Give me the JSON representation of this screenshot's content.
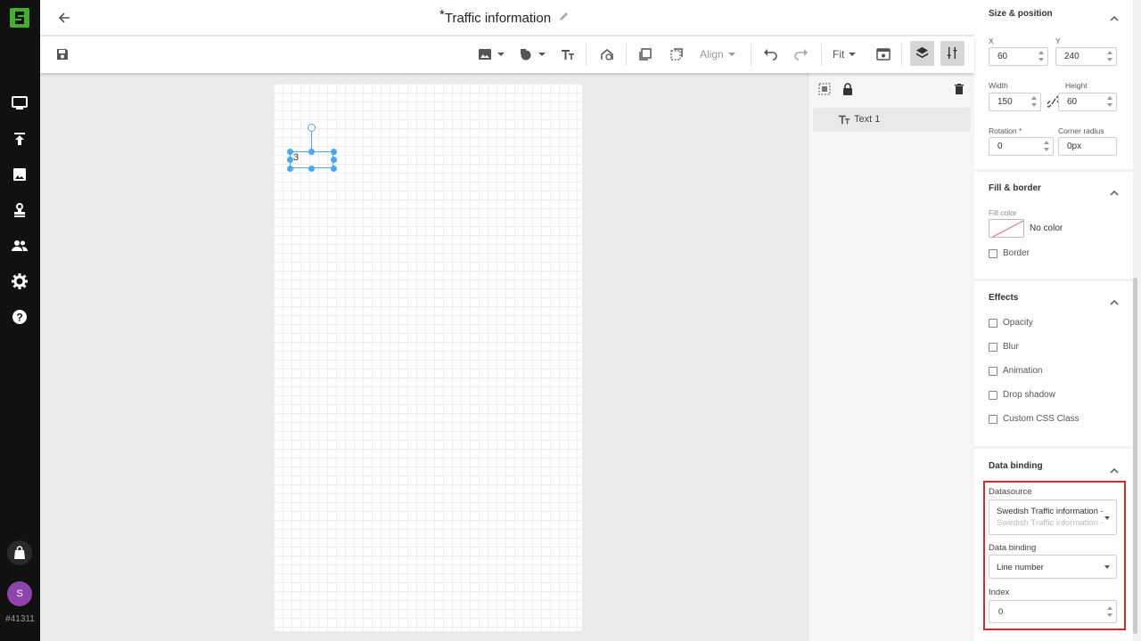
{
  "nav": {
    "icons": [
      "display-icon",
      "publish-icon",
      "image-icon",
      "stamp-icon",
      "users-icon",
      "gear-icon",
      "help-icon"
    ],
    "avatar_letter": "S",
    "avatar_color": "#8e44ad",
    "user_id": "#41311",
    "brand_color": "#43b02a"
  },
  "header": {
    "modified_marker": "*",
    "title": "Traffic information"
  },
  "toolbar": {
    "align_label": "Align",
    "zoom_label": "Fit"
  },
  "canvas": {
    "element_text": "3"
  },
  "layers": {
    "items": [
      {
        "label": "Text 1",
        "icon": "text-type-icon"
      }
    ]
  },
  "props": {
    "size_position": {
      "title": "Size & position",
      "x_label": "X",
      "x_value": "60",
      "y_label": "Y",
      "y_value": "240",
      "width_label": "Width",
      "width_value": "150",
      "height_label": "Height",
      "height_value": "60",
      "rotation_label": "Rotation *",
      "rotation_value": "0",
      "radius_label": "Corner radius",
      "radius_value": "0px"
    },
    "fill_border": {
      "title": "Fill & border",
      "fill_label": "Fill color",
      "fill_value": "No color",
      "border_label": "Border"
    },
    "effects": {
      "title": "Effects",
      "items": [
        "Opacity",
        "Blur",
        "Animation",
        "Drop shadow",
        "Custom CSS Class"
      ]
    },
    "data_binding": {
      "title": "Data binding",
      "datasource_label": "Datasource",
      "datasource_value": "Swedish Traffic information - ",
      "datasource_sub": "Swedish Traffic information - ",
      "binding_label": "Data binding",
      "binding_value": "Line number",
      "index_label": "Index",
      "index_value": "0"
    }
  },
  "highlight_color": "#d9262c"
}
